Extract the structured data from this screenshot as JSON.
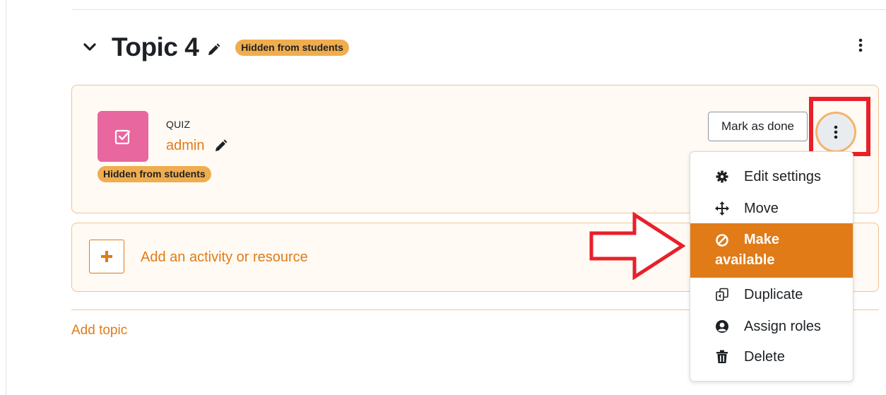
{
  "section": {
    "title": "Topic 4",
    "badge": "Hidden from students"
  },
  "activity": {
    "type_label": "QUIZ",
    "name": "admin",
    "badge": "Hidden from students",
    "mark_done_label": "Mark as done",
    "icon": "quiz-checkbox-icon",
    "icon_color": "#e8679f"
  },
  "add_activity": {
    "label": "Add an activity or resource"
  },
  "add_topic": {
    "label": "Add topic"
  },
  "menu": {
    "items": [
      {
        "label": "Edit settings",
        "icon": "gear-icon"
      },
      {
        "label": "Move",
        "icon": "move-arrows-icon"
      },
      {
        "label_line1": "Make",
        "label_line2": "available",
        "icon": "ban-icon",
        "active": true
      },
      {
        "label": "Duplicate",
        "icon": "duplicate-icon"
      },
      {
        "label": "Assign roles",
        "icon": "user-circle-icon"
      },
      {
        "label": "Delete",
        "icon": "trash-icon"
      }
    ]
  },
  "colors": {
    "accent": "#e07b18",
    "badge": "#f0ad4e",
    "annotation": "#e8202a",
    "card_bg": "#fffaf3"
  }
}
